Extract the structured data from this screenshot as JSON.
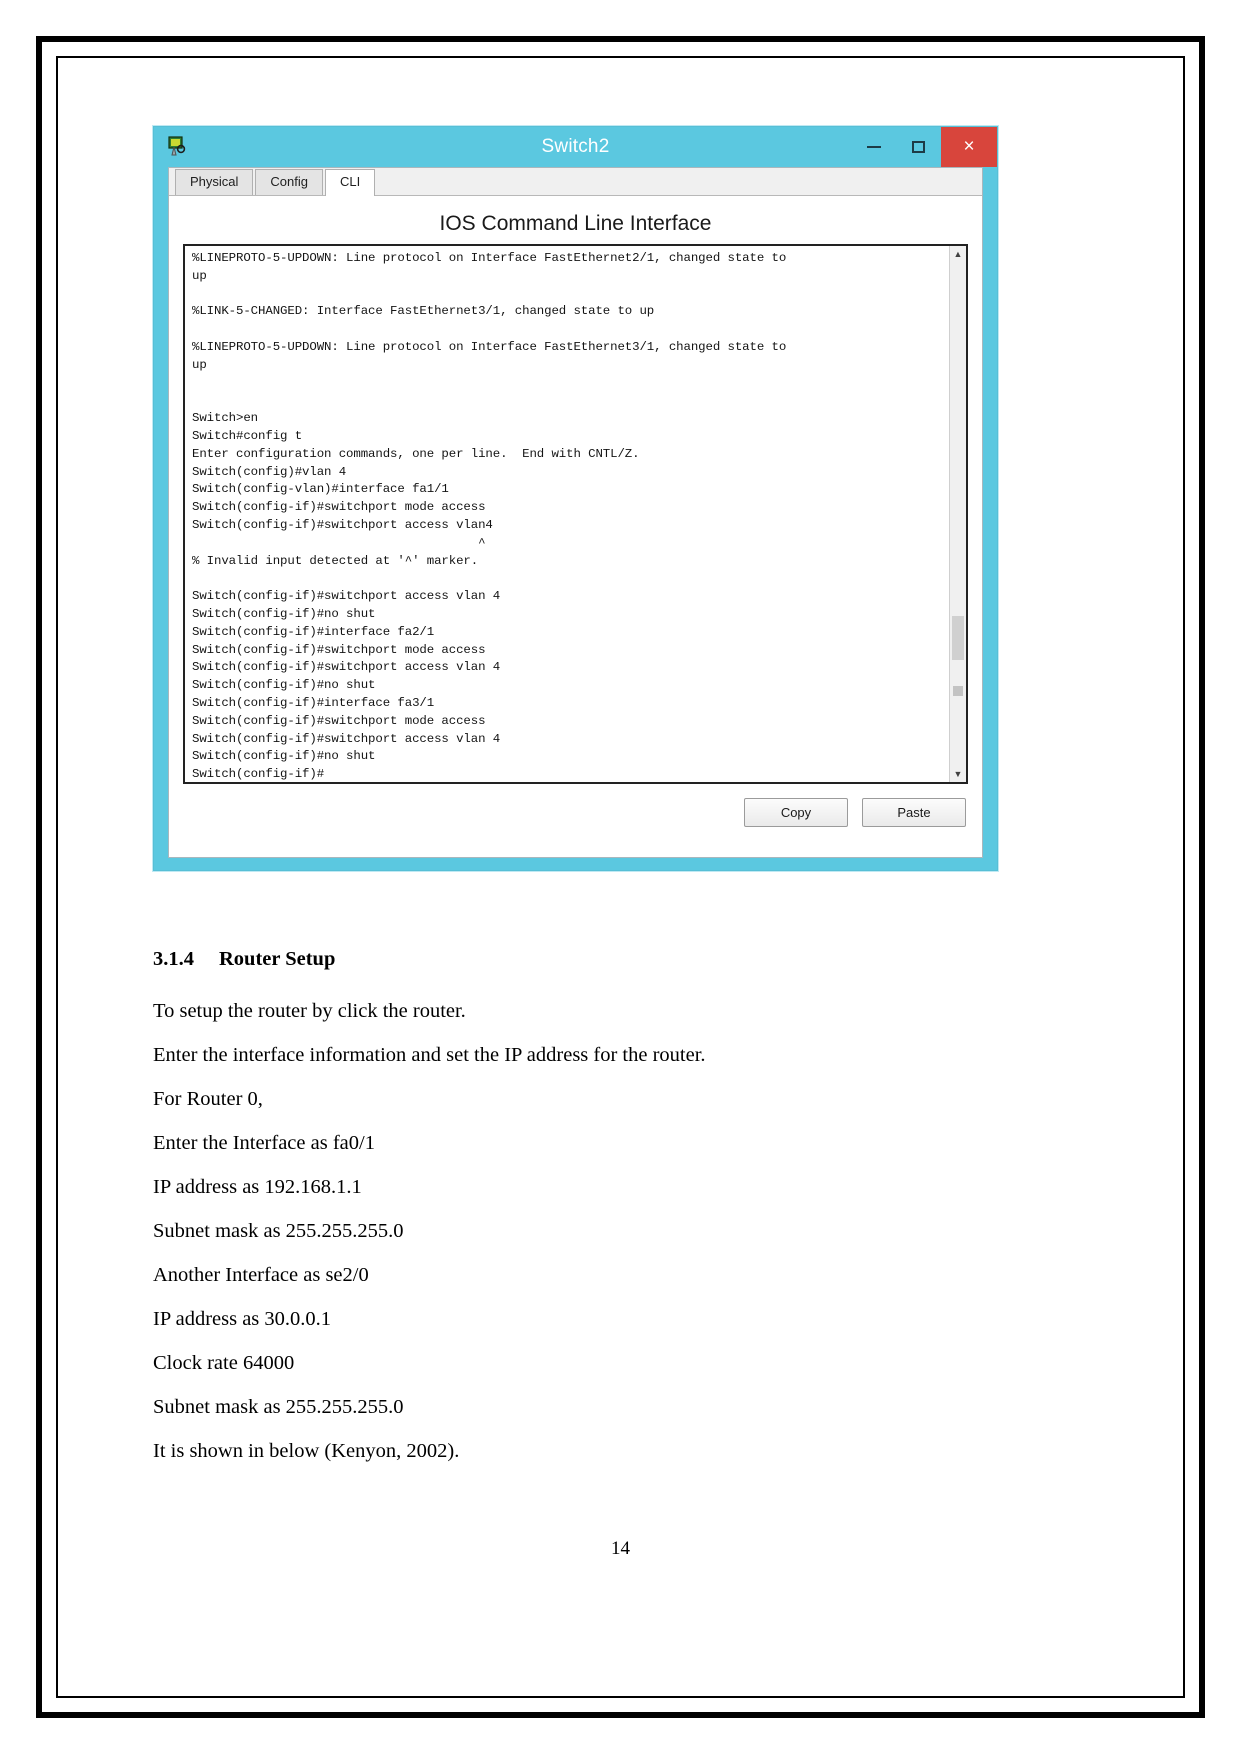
{
  "window": {
    "title": "Switch2",
    "icon": "packet-tracer-switch-icon",
    "controls": {
      "minimize": "–",
      "maximize": "□",
      "close": "×"
    },
    "tabs": [
      {
        "label": "Physical",
        "active": false
      },
      {
        "label": "Config",
        "active": false
      },
      {
        "label": "CLI",
        "active": true
      }
    ],
    "panel_title": "IOS Command Line Interface",
    "terminal_text": "%LINEPROTO-5-UPDOWN: Line protocol on Interface FastEthernet2/1, changed state to\nup\n\n%LINK-5-CHANGED: Interface FastEthernet3/1, changed state to up\n\n%LINEPROTO-5-UPDOWN: Line protocol on Interface FastEthernet3/1, changed state to\nup\n\n\nSwitch>en\nSwitch#config t\nEnter configuration commands, one per line.  End with CNTL/Z.\nSwitch(config)#vlan 4\nSwitch(config-vlan)#interface fa1/1\nSwitch(config-if)#switchport mode access\nSwitch(config-if)#switchport access vlan4\n                                       ^\n% Invalid input detected at '^' marker.\n\nSwitch(config-if)#switchport access vlan 4\nSwitch(config-if)#no shut\nSwitch(config-if)#interface fa2/1\nSwitch(config-if)#switchport mode access\nSwitch(config-if)#switchport access vlan 4\nSwitch(config-if)#no shut\nSwitch(config-if)#interface fa3/1\nSwitch(config-if)#switchport mode access\nSwitch(config-if)#switchport access vlan 4\nSwitch(config-if)#no shut\nSwitch(config-if)#",
    "scroll_up_arrow": "▲",
    "scroll_down_arrow": "▼",
    "buttons": {
      "copy": "Copy",
      "paste": "Paste"
    }
  },
  "document": {
    "heading_number": "3.1.4",
    "heading_text": "Router Setup",
    "paragraphs": [
      "To setup the router by click the router.",
      "Enter the interface information and set the IP address for the router.",
      "For Router 0,",
      "Enter the Interface as fa0/1",
      "IP address as 192.168.1.1",
      "Subnet mask as 255.255.255.0",
      "Another Interface as se2/0",
      "IP address as 30.0.0.1",
      "Clock rate 64000",
      "Subnet mask as 255.255.255.0",
      "It is shown in below (Kenyon, 2002)."
    ],
    "page_number": "14"
  },
  "colors": {
    "titlebar": "#5bc8e0",
    "close_button": "#d8453c",
    "terminal_bg": "#ffffff",
    "terminal_fg": "#141414"
  }
}
